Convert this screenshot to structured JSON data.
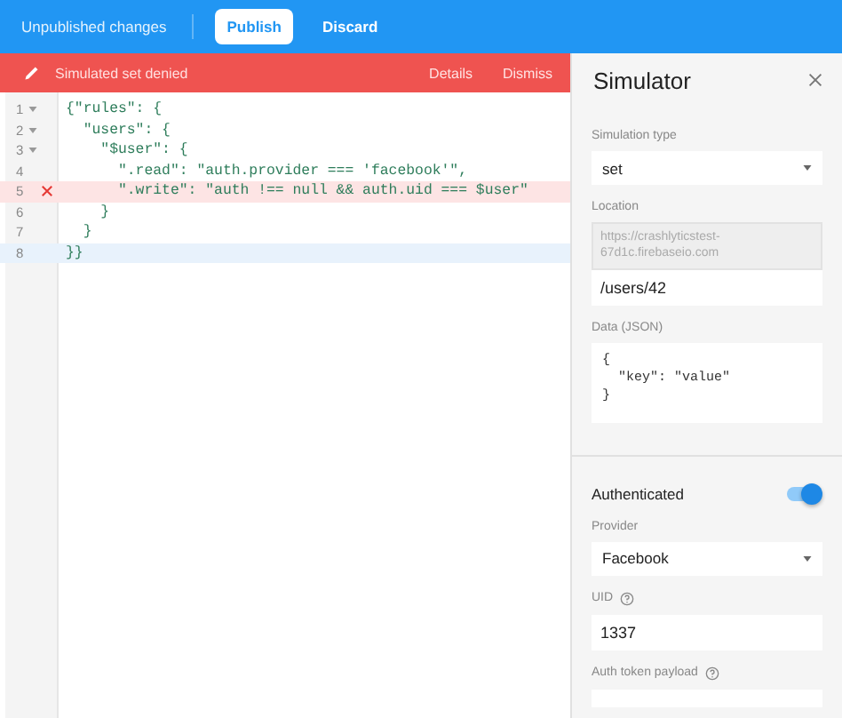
{
  "toolbar": {
    "status": "Unpublished changes",
    "buttons": [
      {
        "label": "Publish",
        "kind": "primary"
      },
      {
        "label": "Discard",
        "kind": "flat"
      }
    ]
  },
  "alert": {
    "message": "Simulated set denied",
    "actions": [
      "Details",
      "Dismiss"
    ]
  },
  "editor": {
    "lines": [
      {
        "number": "1",
        "foldable": true,
        "error": false,
        "current": false,
        "text": "{\"rules\": {"
      },
      {
        "number": "2",
        "foldable": true,
        "error": false,
        "current": false,
        "text": "  \"users\": {"
      },
      {
        "number": "3",
        "foldable": true,
        "error": false,
        "current": false,
        "text": "    \"$user\": {"
      },
      {
        "number": "4",
        "foldable": false,
        "error": false,
        "current": false,
        "text": "      \".read\": \"auth.provider === 'facebook'\","
      },
      {
        "number": "5",
        "foldable": false,
        "error": true,
        "current": false,
        "text": "      \".write\": \"auth !== null && auth.uid === $user\""
      },
      {
        "number": "6",
        "foldable": false,
        "error": false,
        "current": false,
        "text": "    }"
      },
      {
        "number": "7",
        "foldable": false,
        "error": false,
        "current": false,
        "text": "  }"
      },
      {
        "number": "8",
        "foldable": false,
        "error": false,
        "current": true,
        "text": "}}"
      }
    ]
  },
  "simulator": {
    "title": "Simulator",
    "fields": [
      {
        "kind": "select",
        "label": "Simulation type",
        "value": "set"
      },
      {
        "kind": "location",
        "label": "Location",
        "prefix": "https://crashlyticstest-67d1c.firebaseio.com",
        "value": "/users/42"
      },
      {
        "kind": "code",
        "label": "Data (JSON)",
        "value": "{\n  \"key\": \"value\"\n}"
      },
      {
        "kind": "toggle",
        "label": "Authenticated",
        "on": true
      },
      {
        "kind": "select",
        "label": "Provider",
        "value": "Facebook"
      },
      {
        "kind": "text",
        "label": "UID",
        "help": true,
        "value": "1337"
      },
      {
        "kind": "text",
        "label": "Auth token payload",
        "help": true
      }
    ]
  }
}
